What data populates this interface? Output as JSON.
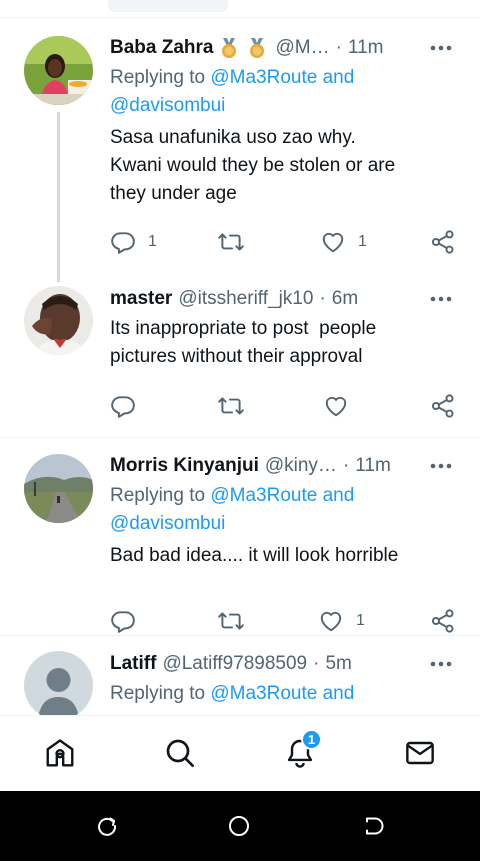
{
  "tweets": [
    {
      "name": "Baba Zahra",
      "handle": "@M…",
      "dot": "·",
      "time": "11m",
      "replying_prefix": "Replying to ",
      "replying_link": "@Ma3Route and",
      "replying_link2": "@davisombui",
      "lines": [
        "Sasa unafunika uso zao why.",
        "Kwani would they be stolen or are",
        "they under age"
      ],
      "reply_count": "1",
      "retweet_count": "",
      "like_count": "1",
      "avatar_icon": "girl-photo-avatar",
      "badges": [
        "medal-icon",
        "medal-icon"
      ]
    },
    {
      "name": "master",
      "handle": "@itssheriff_jk10",
      "dot": "·",
      "time": "6m",
      "lines": [
        "Its inappropriate to post  people",
        "pictures without their approval"
      ],
      "reply_count": "",
      "retweet_count": "",
      "like_count": "",
      "avatar_icon": "man-photo-avatar"
    },
    {
      "name": "Morris Kinyanjui",
      "handle": "@kiny…",
      "dot": "·",
      "time": "11m",
      "replying_prefix": "Replying to ",
      "replying_link": "@Ma3Route and",
      "replying_link2": "@davisombui",
      "lines": [
        "Bad bad idea.... it will look horrible"
      ],
      "reply_count": "",
      "retweet_count": "",
      "like_count": "1",
      "avatar_icon": "road-photo-avatar"
    },
    {
      "name": "Latiff",
      "handle": "@Latiff97898509",
      "dot": "·",
      "time": "5m",
      "replying_prefix": "Replying to ",
      "replying_link": "@Ma3Route and",
      "avatar_icon": "default-profile-avatar"
    }
  ],
  "tabs": [
    {
      "name": "home",
      "icon": "home-icon"
    },
    {
      "name": "search",
      "icon": "search-icon"
    },
    {
      "name": "notifications",
      "icon": "bell-icon"
    },
    {
      "name": "messages",
      "icon": "mail-icon"
    }
  ],
  "notification_badge": "1",
  "colors": {
    "link": "#1d9bf0",
    "secondary_text": "#536471",
    "primary_text": "#0f1419",
    "divider": "#eff3f4",
    "badge": "#1d9bf0",
    "medal": "#e6a93b"
  }
}
